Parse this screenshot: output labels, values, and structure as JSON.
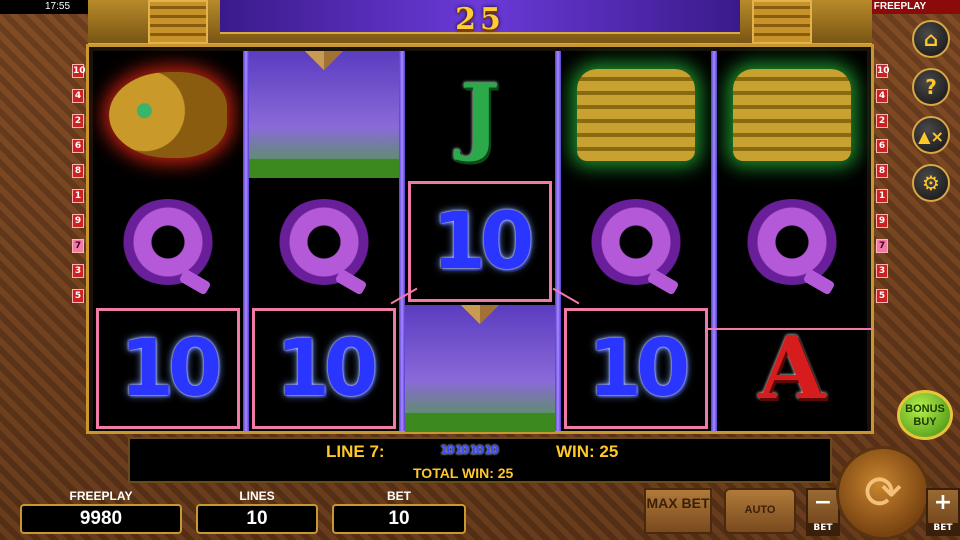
{
  "status_bar": {
    "time": "17:55",
    "mode": "FREEPLAY"
  },
  "header": {
    "win_display": "25"
  },
  "reels": [
    [
      "fish-idol",
      "Q",
      "10"
    ],
    [
      "pyramid",
      "Q",
      "10"
    ],
    [
      "J",
      "10",
      "pyramid"
    ],
    [
      "jaguar-idol",
      "Q",
      "10"
    ],
    [
      "jaguar-idol",
      "Q",
      "A"
    ]
  ],
  "symbol_text": {
    "Q": "",
    "10": "10",
    "J": "J",
    "A": "A"
  },
  "line_markers_left": [
    "10",
    "4",
    "2",
    "6",
    "8",
    "1",
    "9",
    "7",
    "3",
    "5"
  ],
  "line_markers_right": [
    "10",
    "4",
    "2",
    "6",
    "8",
    "1",
    "9",
    "7",
    "3",
    "5"
  ],
  "active_line": "7",
  "info": {
    "line_text": "LINE 7:",
    "line_symbols": [
      "10",
      "10",
      "10",
      "10"
    ],
    "win_text": "WIN: 25",
    "total_win_text": "TOTAL WIN: 25"
  },
  "meters": {
    "freeplay": {
      "label": "FREEPLAY",
      "value": "9980"
    },
    "lines": {
      "label": "LINES",
      "value": "10"
    },
    "bet": {
      "label": "BET",
      "value": "10"
    }
  },
  "buttons": {
    "max_bet": "MAX BET",
    "auto": "AUTO",
    "bet_minus_caption": "BET",
    "bet_plus_caption": "BET",
    "bonus_buy": "BONUS BUY"
  },
  "side_controls": [
    "home-icon",
    "help-icon",
    "sound-muted-icon",
    "settings-icon"
  ],
  "colors": {
    "highlight": "#f07aa8",
    "gold": "#ffc72a",
    "reel_bg": "#000000"
  }
}
